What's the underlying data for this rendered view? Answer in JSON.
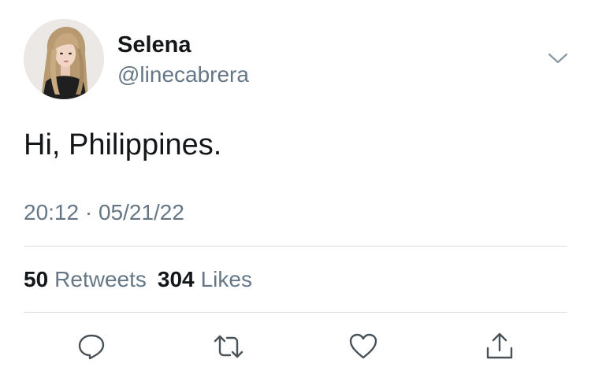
{
  "user": {
    "display_name": "Selena",
    "handle": "@linecabrera"
  },
  "tweet": {
    "text": "Hi, Philippines.",
    "timestamp": "20:12 · 05/21/22"
  },
  "stats": {
    "retweets_count": "50",
    "retweets_label": "Retweets",
    "likes_count": "304",
    "likes_label": "Likes"
  },
  "icons": {
    "menu": "chevron-down-icon",
    "reply": "reply-icon",
    "retweet": "retweet-icon",
    "like": "heart-icon",
    "share": "share-icon"
  },
  "colors": {
    "text": "#14171a",
    "secondary": "#657786",
    "icon": "#4a5259",
    "divider": "#d9dde0"
  }
}
